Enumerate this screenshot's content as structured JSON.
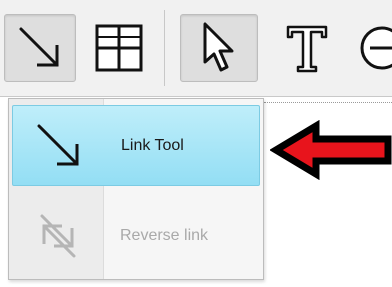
{
  "toolbar": {
    "buttons": [
      {
        "name": "link-tool-toolbar-button",
        "icon": "diagonal-arrow-icon",
        "pressed": true
      },
      {
        "name": "table-toolbar-button",
        "icon": "grid-icon",
        "pressed": false
      },
      {
        "name": "select-toolbar-button",
        "icon": "cursor-pointer-icon",
        "pressed": true
      },
      {
        "name": "text-toolbar-button",
        "icon": "text-t-icon",
        "pressed": false
      },
      {
        "name": "zoom-out-toolbar-button",
        "icon": "circle-minus-icon",
        "pressed": false
      }
    ]
  },
  "dropdown": {
    "items": [
      {
        "label": "Link Tool",
        "icon": "diagonal-arrow-icon",
        "state": "highlighted"
      },
      {
        "label": "Reverse link",
        "icon": "reverse-arrows-icon",
        "state": "disabled"
      }
    ]
  },
  "annotation": {
    "icon": "red-arrow-pointer-icon",
    "color": "#e8141c",
    "outline": "#000000"
  },
  "colors": {
    "highlight": "#9fe2f6",
    "toolbar_bg": "#f1f1f1"
  }
}
